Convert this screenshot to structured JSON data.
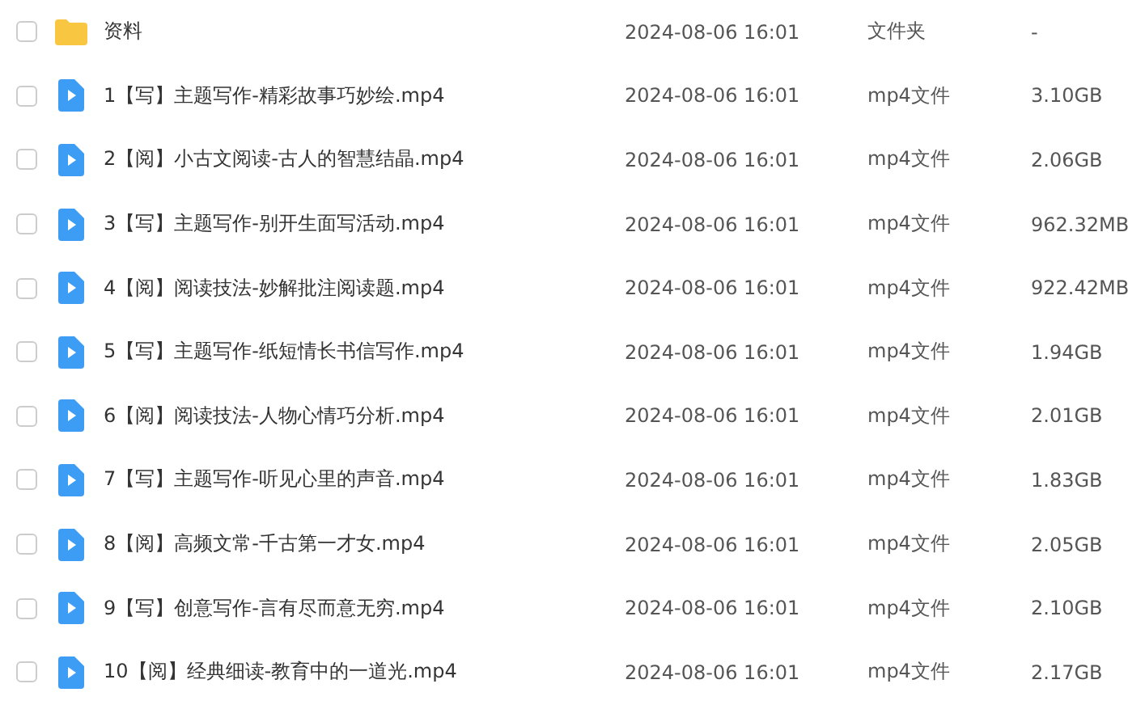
{
  "files": [
    {
      "kind": "folder",
      "checked": false,
      "name": "资料",
      "modified": "2024-08-06 16:01",
      "type": "文件夹",
      "size": "-"
    },
    {
      "kind": "video",
      "checked": false,
      "name": "1【写】主题写作-精彩故事巧妙绘.mp4",
      "modified": "2024-08-06 16:01",
      "type": "mp4文件",
      "size": "3.10GB"
    },
    {
      "kind": "video",
      "checked": false,
      "name": "2【阅】小古文阅读-古人的智慧结晶.mp4",
      "modified": "2024-08-06 16:01",
      "type": "mp4文件",
      "size": "2.06GB"
    },
    {
      "kind": "video",
      "checked": false,
      "name": "3【写】主题写作-别开生面写活动.mp4",
      "modified": "2024-08-06 16:01",
      "type": "mp4文件",
      "size": "962.32MB"
    },
    {
      "kind": "video",
      "checked": false,
      "name": "4【阅】阅读技法-妙解批注阅读题.mp4",
      "modified": "2024-08-06 16:01",
      "type": "mp4文件",
      "size": "922.42MB"
    },
    {
      "kind": "video",
      "checked": false,
      "name": "5【写】主题写作-纸短情长书信写作.mp4",
      "modified": "2024-08-06 16:01",
      "type": "mp4文件",
      "size": "1.94GB"
    },
    {
      "kind": "video",
      "checked": false,
      "name": "6【阅】阅读技法-人物心情巧分析.mp4",
      "modified": "2024-08-06 16:01",
      "type": "mp4文件",
      "size": "2.01GB"
    },
    {
      "kind": "video",
      "checked": false,
      "name": "7【写】主题写作-听见心里的声音.mp4",
      "modified": "2024-08-06 16:01",
      "type": "mp4文件",
      "size": "1.83GB"
    },
    {
      "kind": "video",
      "checked": false,
      "name": "8【阅】高频文常-千古第一才女.mp4",
      "modified": "2024-08-06 16:01",
      "type": "mp4文件",
      "size": "2.05GB"
    },
    {
      "kind": "video",
      "checked": false,
      "name": "9【写】创意写作-言有尽而意无穷.mp4",
      "modified": "2024-08-06 16:01",
      "type": "mp4文件",
      "size": "2.10GB"
    },
    {
      "kind": "video",
      "checked": false,
      "name": "10【阅】经典细读-教育中的一道光.mp4",
      "modified": "2024-08-06 16:01",
      "type": "mp4文件",
      "size": "2.17GB"
    }
  ]
}
